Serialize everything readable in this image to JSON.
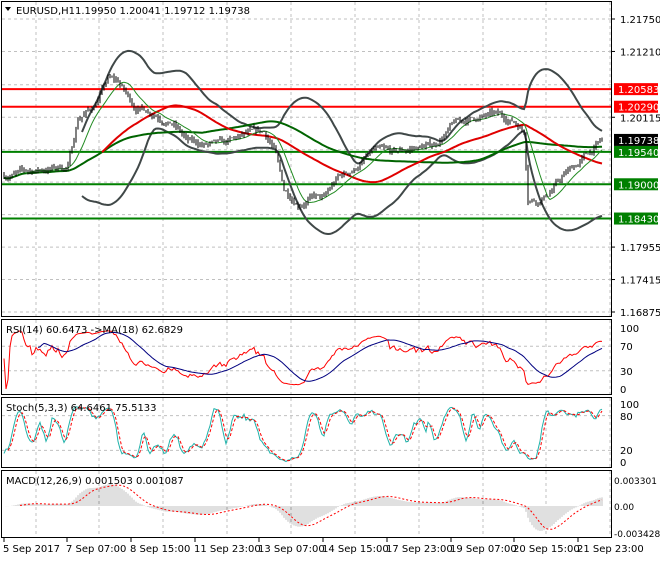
{
  "header": {
    "arrow_icon": "triangle-down",
    "symbol": "EURUSD,H1",
    "ohlc": "1.19950 1.20041 1.19712 1.19738"
  },
  "price_axis": {
    "labels": [
      "1.21750",
      "1.21210",
      "1.20115",
      "1.17955",
      "1.17415",
      "1.16875"
    ],
    "ticks": [
      1.2175,
      1.2121,
      1.20115,
      1.17955,
      1.17415,
      1.16875
    ]
  },
  "levels": [
    {
      "price": 1.20583,
      "label": "1.20583",
      "color": "#ff0000"
    },
    {
      "price": 1.2029,
      "label": "1.20290",
      "color": "#ff0000"
    },
    {
      "price": 1.1954,
      "label": "1.19540",
      "color": "#008000"
    },
    {
      "price": 1.19,
      "label": "1.19000",
      "color": "#008000"
    },
    {
      "price": 1.1843,
      "label": "1.18430",
      "color": "#008000"
    }
  ],
  "current_price": {
    "value": 1.19738,
    "label": "1.19738",
    "color": "#000000"
  },
  "time_axis": [
    "5 Sep 2017",
    "7 Sep 07:00",
    "8 Sep 15:00",
    "11 Sep 23:00",
    "13 Sep 07:00",
    "14 Sep 15:00",
    "17 Sep 23:00",
    "19 Sep 07:00",
    "20 Sep 15:00",
    "21 Sep 23:00"
  ],
  "rsi": {
    "title": "RSI(14) 60.6473  ->MA(18) 62.6829",
    "levels": [
      "100",
      "70",
      "30",
      "0"
    ],
    "color": "#ff0000",
    "ma_color": "#000080"
  },
  "stoch": {
    "title": "Stoch(5,3,3) 64.6461 75.5133",
    "levels": [
      "100",
      "80",
      "20",
      "0"
    ],
    "color": "#20b2aa",
    "signal_color": "#ff0000"
  },
  "macd": {
    "title": "MACD(12,26,9) 0.001503 0.001087",
    "levels": [
      "0.003301",
      "0.00",
      "-0.003428"
    ],
    "range": [
      -0.003428,
      0.003301
    ],
    "hist_color": "#c0c0c0",
    "signal_color": "#ff0000"
  },
  "chart_data": {
    "type": "line",
    "title": "EURUSD,H1",
    "timeframe_hours_per_bar": 1,
    "bars": 300,
    "ylim": [
      1.16875,
      1.2175
    ],
    "close_keypoints_hour_price": [
      [
        0,
        1.1915
      ],
      [
        10,
        1.192
      ],
      [
        20,
        1.1925
      ],
      [
        32,
        1.193
      ],
      [
        37,
        1.201
      ],
      [
        45,
        1.203
      ],
      [
        52,
        1.2075
      ],
      [
        57,
        1.207
      ],
      [
        65,
        1.203
      ],
      [
        75,
        1.202
      ],
      [
        85,
        1.2
      ],
      [
        92,
        1.197
      ],
      [
        100,
        1.1965
      ],
      [
        110,
        1.1965
      ],
      [
        120,
        1.198
      ],
      [
        130,
        1.1985
      ],
      [
        135,
        1.196
      ],
      [
        140,
        1.189
      ],
      [
        147,
        1.187
      ],
      [
        155,
        1.188
      ],
      [
        160,
        1.1875
      ],
      [
        167,
        1.191
      ],
      [
        175,
        1.1925
      ],
      [
        185,
        1.1955
      ],
      [
        195,
        1.195
      ],
      [
        205,
        1.196
      ],
      [
        215,
        1.1965
      ],
      [
        225,
        1.2
      ],
      [
        235,
        1.201
      ],
      [
        245,
        1.2015
      ],
      [
        255,
        1.2005
      ],
      [
        260,
        1.199
      ],
      [
        262,
        1.188
      ],
      [
        267,
        1.1875
      ],
      [
        272,
        1.1885
      ],
      [
        280,
        1.1915
      ],
      [
        287,
        1.1935
      ],
      [
        295,
        1.196
      ],
      [
        299,
        1.19738
      ]
    ],
    "overlays": [
      "Bollinger Bands",
      "MA fast (green)",
      "MA 50 (red)",
      "MA 100 (dark green)"
    ]
  }
}
